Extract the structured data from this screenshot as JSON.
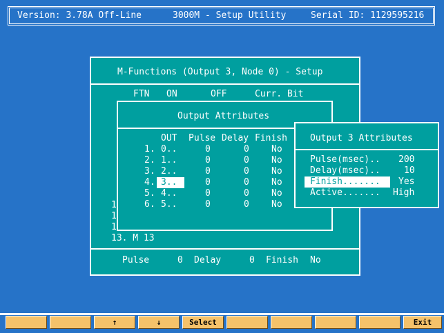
{
  "header": {
    "version": "Version: 3.78A Off-Line",
    "app_title": "3000M - Setup Utility",
    "serial": "Serial ID: 1129595216"
  },
  "mfunctions": {
    "title": "M-Functions (Output 3, Node 0) - Setup",
    "columns": [
      "FTN",
      "ON",
      "OFF",
      "Curr. Bit"
    ],
    "rows_visible": [
      "1",
      "1",
      "1",
      "13. M 13"
    ],
    "footer": {
      "pulse_label": "Pulse",
      "pulse_value": "0",
      "delay_label": "Delay",
      "delay_value": "0",
      "finish_label": "Finish",
      "finish_value": "No"
    }
  },
  "output_attributes": {
    "title": "Output Attributes",
    "headers": [
      "OUT",
      "Pulse",
      "Delay",
      "Finish"
    ],
    "rows": [
      {
        "idx": "1.",
        "out": "0..",
        "pulse": "0",
        "delay": "0",
        "finish": "No"
      },
      {
        "idx": "2.",
        "out": "1..",
        "pulse": "0",
        "delay": "0",
        "finish": "No"
      },
      {
        "idx": "3.",
        "out": "2..",
        "pulse": "0",
        "delay": "0",
        "finish": "No"
      },
      {
        "idx": "4.",
        "out": "3..",
        "pulse": "0",
        "delay": "0",
        "finish": "No"
      },
      {
        "idx": "5.",
        "out": "4..",
        "pulse": "0",
        "delay": "0",
        "finish": "No"
      },
      {
        "idx": "6.",
        "out": "5..",
        "pulse": "0",
        "delay": "0",
        "finish": "No"
      }
    ],
    "selected_row": 3
  },
  "output3": {
    "title": "Output 3 Attributes",
    "fields": [
      {
        "label": "Pulse(msec)..",
        "value": "200"
      },
      {
        "label": "Delay(msec)..",
        "value": "10"
      },
      {
        "label": "Finish.......",
        "value": "Yes"
      },
      {
        "label": "Active.......",
        "value": "High"
      }
    ],
    "selected_field": 2
  },
  "fkeys": [
    "",
    "",
    "↑",
    "↓",
    "Select",
    "",
    "",
    "",
    "",
    "Exit"
  ],
  "colors": {
    "background": "#2673c8",
    "panel": "#009f9f",
    "fkey": "#f5c26a"
  }
}
